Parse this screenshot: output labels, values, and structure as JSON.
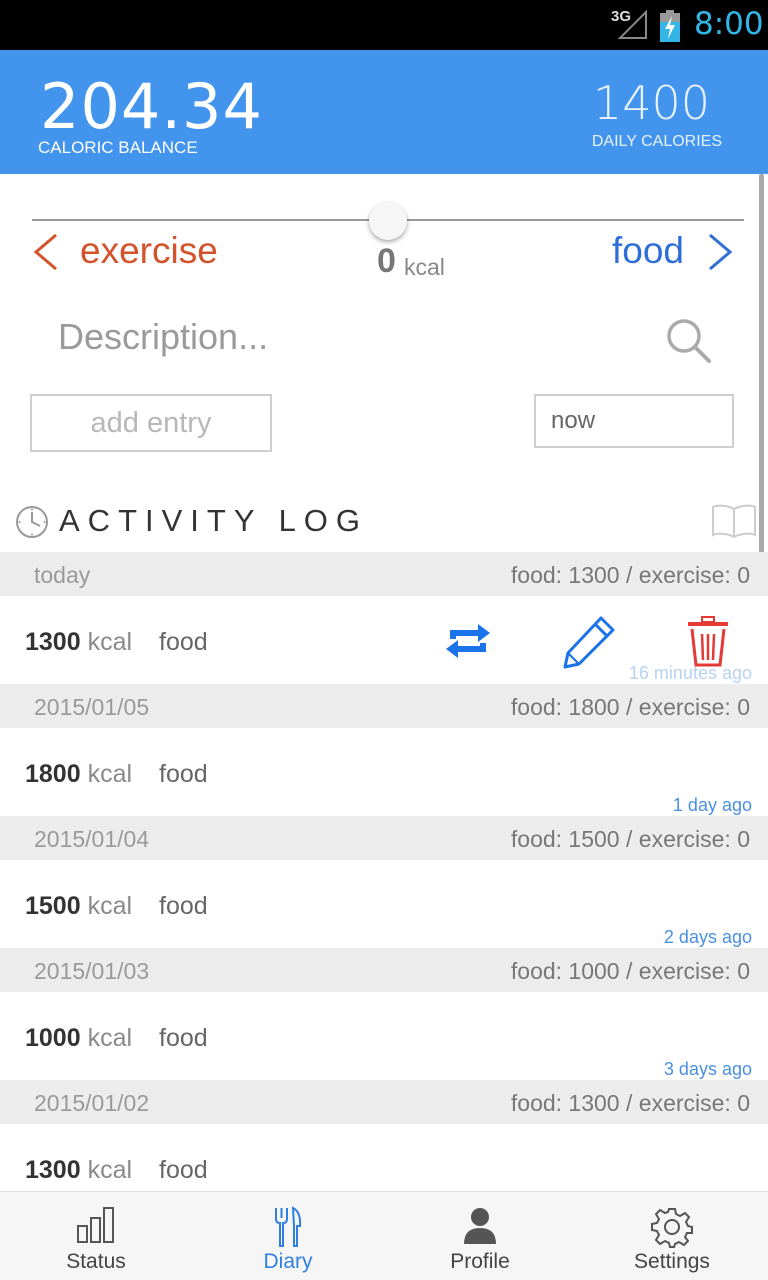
{
  "status_bar": {
    "network": "3G",
    "time": "8:00"
  },
  "header": {
    "caloric_balance": "204.34",
    "caloric_balance_label": "CALORIC BALANCE",
    "daily_calories": "1400",
    "daily_calories_label": "DAILY CALORIES"
  },
  "slider": {
    "left_label": "exercise",
    "right_label": "food",
    "value": "0",
    "unit": "kcal",
    "position": 0.5
  },
  "entry_form": {
    "description_placeholder": "Description...",
    "add_entry_label": "add entry",
    "time_value": "now"
  },
  "activity_log": {
    "title": "ACTIVITY LOG",
    "days": [
      {
        "date": "today",
        "summary": "food: 1300 / exercise: 0",
        "entries": [
          {
            "kcal": "1300",
            "unit": "kcal",
            "type": "food",
            "ago": "16 minutes ago"
          }
        ]
      },
      {
        "date": "2015/01/05",
        "summary": "food: 1800 / exercise: 0",
        "entries": [
          {
            "kcal": "1800",
            "unit": "kcal",
            "type": "food",
            "ago": "1 day ago"
          }
        ]
      },
      {
        "date": "2015/01/04",
        "summary": "food: 1500 / exercise: 0",
        "entries": [
          {
            "kcal": "1500",
            "unit": "kcal",
            "type": "food",
            "ago": "2 days ago"
          }
        ]
      },
      {
        "date": "2015/01/03",
        "summary": "food: 1000 / exercise: 0",
        "entries": [
          {
            "kcal": "1000",
            "unit": "kcal",
            "type": "food",
            "ago": "3 days ago"
          }
        ]
      },
      {
        "date": "2015/01/02",
        "summary": "food: 1300 / exercise: 0",
        "entries": [
          {
            "kcal": "1300",
            "unit": "kcal",
            "type": "food",
            "ago": ""
          }
        ]
      }
    ]
  },
  "nav": {
    "items": [
      {
        "label": "Status",
        "icon": "bar-chart-icon"
      },
      {
        "label": "Diary",
        "icon": "fork-knife-icon",
        "active": true
      },
      {
        "label": "Profile",
        "icon": "person-icon"
      },
      {
        "label": "Settings",
        "icon": "gear-icon"
      }
    ]
  },
  "colors": {
    "header": "#4294ed",
    "exercise": "#d3532b",
    "food": "#2f6ed8",
    "action_blue": "#1a73e8",
    "delete_red": "#e53935"
  }
}
